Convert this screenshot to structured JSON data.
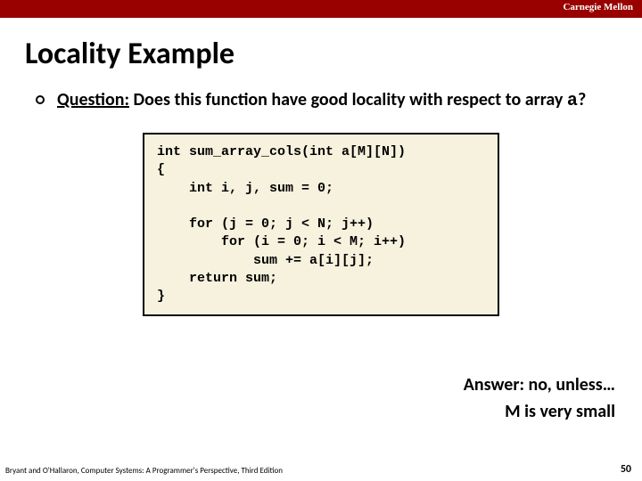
{
  "header": {
    "institution": "Carnegie Mellon"
  },
  "title": "Locality Example",
  "question": {
    "label": "Question:",
    "text_before": " Does this function have good locality with respect to array ",
    "code_var": "a",
    "text_after": "?"
  },
  "code": "int sum_array_cols(int a[M][N])\n{\n    int i, j, sum = 0;\n\n    for (j = 0; j < N; j++)\n        for (i = 0; i < M; i++)\n            sum += a[i][j];\n    return sum;\n}",
  "answer": {
    "line1": "Answer: no, unless…",
    "line2": "M is very small"
  },
  "footer": {
    "attribution": "Bryant and O'Hallaron, Computer Systems: A Programmer's Perspective, Third Edition",
    "page_number": "50"
  }
}
